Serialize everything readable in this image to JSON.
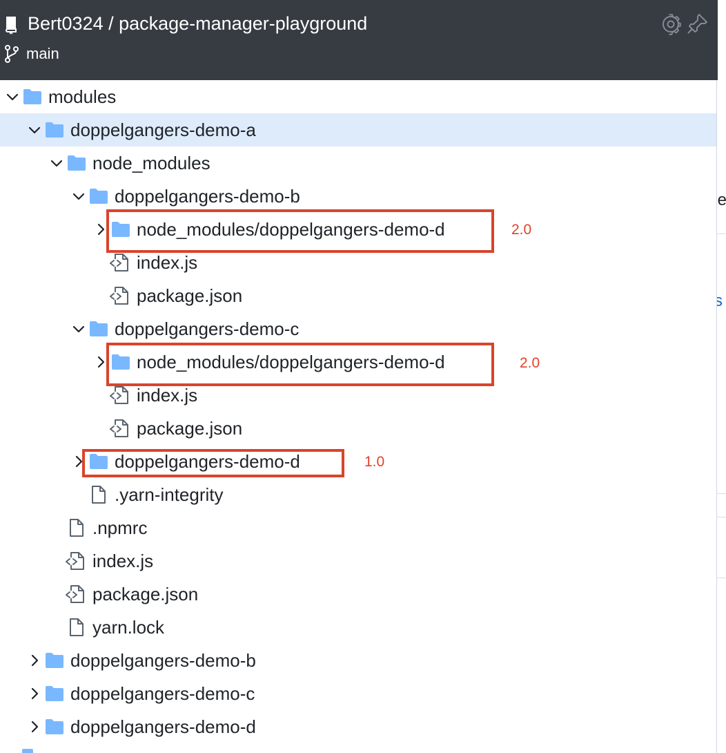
{
  "header": {
    "repo_title": "Bert0324 / package-manager-playground",
    "branch": "main",
    "icons": [
      "repo-icon",
      "branch-icon",
      "gear-icon",
      "pin-icon"
    ]
  },
  "tree": [
    {
      "label": "modules",
      "type": "folder",
      "expanded": true,
      "chevron": "chevron-down-icon",
      "icon": "folder-icon"
    },
    {
      "label": "doppelgangers-demo-a",
      "type": "folder",
      "expanded": true,
      "selected": true,
      "chevron": "chevron-down-icon",
      "icon": "folder-icon"
    },
    {
      "label": "node_modules",
      "type": "folder",
      "expanded": true,
      "chevron": "chevron-down-icon",
      "icon": "folder-icon"
    },
    {
      "label": "doppelgangers-demo-b",
      "type": "folder",
      "expanded": true,
      "chevron": "chevron-down-icon",
      "icon": "folder-icon"
    },
    {
      "label": "node_modules/doppelgangers-demo-d",
      "type": "folder",
      "expanded": false,
      "highlighted": true,
      "annotation": "2.0",
      "chevron": "chevron-right-icon",
      "icon": "folder-icon"
    },
    {
      "label": "index.js",
      "type": "code-file",
      "icon": "code-file-icon"
    },
    {
      "label": "package.json",
      "type": "code-file",
      "icon": "code-file-icon"
    },
    {
      "label": "doppelgangers-demo-c",
      "type": "folder",
      "expanded": true,
      "chevron": "chevron-down-icon",
      "icon": "folder-icon"
    },
    {
      "label": "node_modules/doppelgangers-demo-d",
      "type": "folder",
      "expanded": false,
      "highlighted": true,
      "annotation": "2.0",
      "chevron": "chevron-right-icon",
      "icon": "folder-icon"
    },
    {
      "label": "index.js",
      "type": "code-file",
      "icon": "code-file-icon"
    },
    {
      "label": "package.json",
      "type": "code-file",
      "icon": "code-file-icon"
    },
    {
      "label": "doppelgangers-demo-d",
      "type": "folder",
      "expanded": false,
      "highlighted": true,
      "annotation": "1.0",
      "chevron": "chevron-right-icon",
      "icon": "folder-icon"
    },
    {
      "label": ".yarn-integrity",
      "type": "file",
      "icon": "file-icon"
    },
    {
      "label": ".npmrc",
      "type": "file",
      "icon": "file-icon"
    },
    {
      "label": "index.js",
      "type": "code-file",
      "icon": "code-file-icon"
    },
    {
      "label": "package.json",
      "type": "code-file",
      "icon": "code-file-icon"
    },
    {
      "label": "yarn.lock",
      "type": "file",
      "icon": "file-icon"
    },
    {
      "label": "doppelgangers-demo-b",
      "type": "folder",
      "expanded": false,
      "chevron": "chevron-right-icon",
      "icon": "folder-icon"
    },
    {
      "label": "doppelgangers-demo-c",
      "type": "folder",
      "expanded": false,
      "chevron": "chevron-right-icon",
      "icon": "folder-icon"
    },
    {
      "label": "doppelgangers-demo-d",
      "type": "folder",
      "expanded": false,
      "chevron": "chevron-right-icon",
      "icon": "folder-icon"
    }
  ],
  "right_panel": {
    "fragment_top": "oje",
    "fragment_link": "s"
  },
  "colors": {
    "header_bg": "#373c43",
    "selected_bg": "#ddebfb",
    "folder": "#79b8ff",
    "highlight": "#d9442c",
    "annotation": "#e2422a",
    "link": "#0969da"
  }
}
